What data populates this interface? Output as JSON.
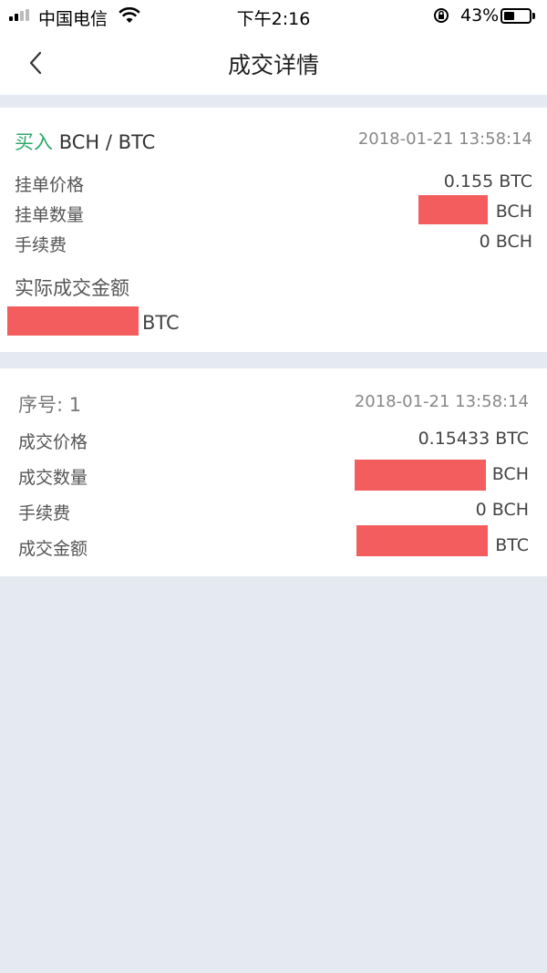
{
  "status_bar": {
    "carrier": "中国电信",
    "time": "下午2:16",
    "battery_percent_text": "43%",
    "battery_level": 0.43
  },
  "nav": {
    "title": "成交详情",
    "back_icon": "chevron-left-icon"
  },
  "order": {
    "side": "买入",
    "pair": "BCH / BTC",
    "time": "2018-01-21 13:58:14",
    "rows": [
      {
        "label": "挂单价格",
        "value": "0.155 BTC"
      },
      {
        "label": "挂单数量",
        "unit": "BCH"
      },
      {
        "label": "手续费",
        "value": "0 BCH"
      }
    ],
    "actual_amount_label": "实际成交金额",
    "actual_amount_unit": "BTC"
  },
  "trade": {
    "serial_label": "序号: 1",
    "time": "2018-01-21 13:58:14",
    "rows": [
      {
        "label": "成交价格",
        "value": "0.15433 BTC"
      },
      {
        "label": "成交数量",
        "unit": "BCH"
      },
      {
        "label": "手续费",
        "value": "0 BCH"
      },
      {
        "label": "成交金额",
        "unit": "BTC"
      }
    ]
  },
  "colors": {
    "buy_green": "#2daa6a",
    "redaction_red": "#f45d5d",
    "background": "#e5e9f2"
  }
}
